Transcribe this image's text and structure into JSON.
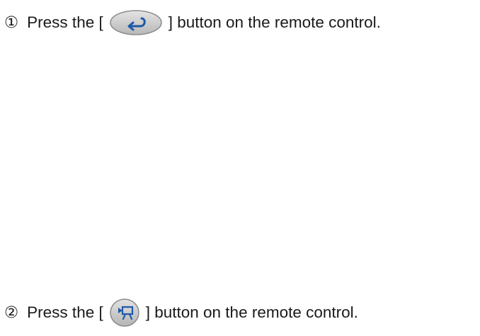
{
  "steps": [
    {
      "number": "①",
      "before": "Press the [",
      "button_icon": "return-arrow-icon",
      "after": "] button on the remote control."
    },
    {
      "number": "②",
      "before": "Press the [",
      "button_icon": "projector-camera-icon",
      "after": "] button on the remote control."
    }
  ],
  "colors": {
    "button_face": "#cfcfcf",
    "button_edge": "#8a8a8a",
    "icon": "#1e5aa8"
  }
}
